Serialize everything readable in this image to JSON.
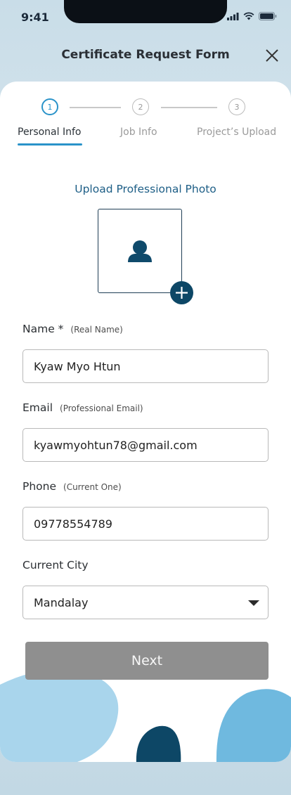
{
  "status_bar": {
    "time": "9:41"
  },
  "header": {
    "title": "Certificate Request Form"
  },
  "stepper": {
    "steps": [
      "1",
      "2",
      "3"
    ]
  },
  "tabs": [
    {
      "label": "Personal Info",
      "active": true
    },
    {
      "label": "Job Info",
      "active": false
    },
    {
      "label": "Project’s Upload",
      "active": false
    }
  ],
  "photo": {
    "label": "Upload Professional Photo"
  },
  "fields": {
    "name": {
      "label": "Name *",
      "hint": "(Real Name)",
      "value": "Kyaw Myo Htun"
    },
    "email": {
      "label": "Email",
      "hint": "(Professional Email)",
      "value": "kyawmyohtun78@gmail.com"
    },
    "phone": {
      "label": "Phone",
      "hint": "(Current One)",
      "value": "09778554789"
    },
    "city": {
      "label": "Current City",
      "value": "Mandalay"
    }
  },
  "actions": {
    "next_label": "Next"
  },
  "colors": {
    "accent": "#2a93c9",
    "primary_dark": "#0d4766",
    "button_disabled": "#8f8f8f",
    "blob_light": "#a9d5ec",
    "blob_medium": "#6fb9df"
  },
  "icons": [
    "signal-icon",
    "wifi-icon",
    "battery-icon",
    "close-icon",
    "person-placeholder-icon",
    "plus-icon",
    "chevron-down-icon"
  ]
}
